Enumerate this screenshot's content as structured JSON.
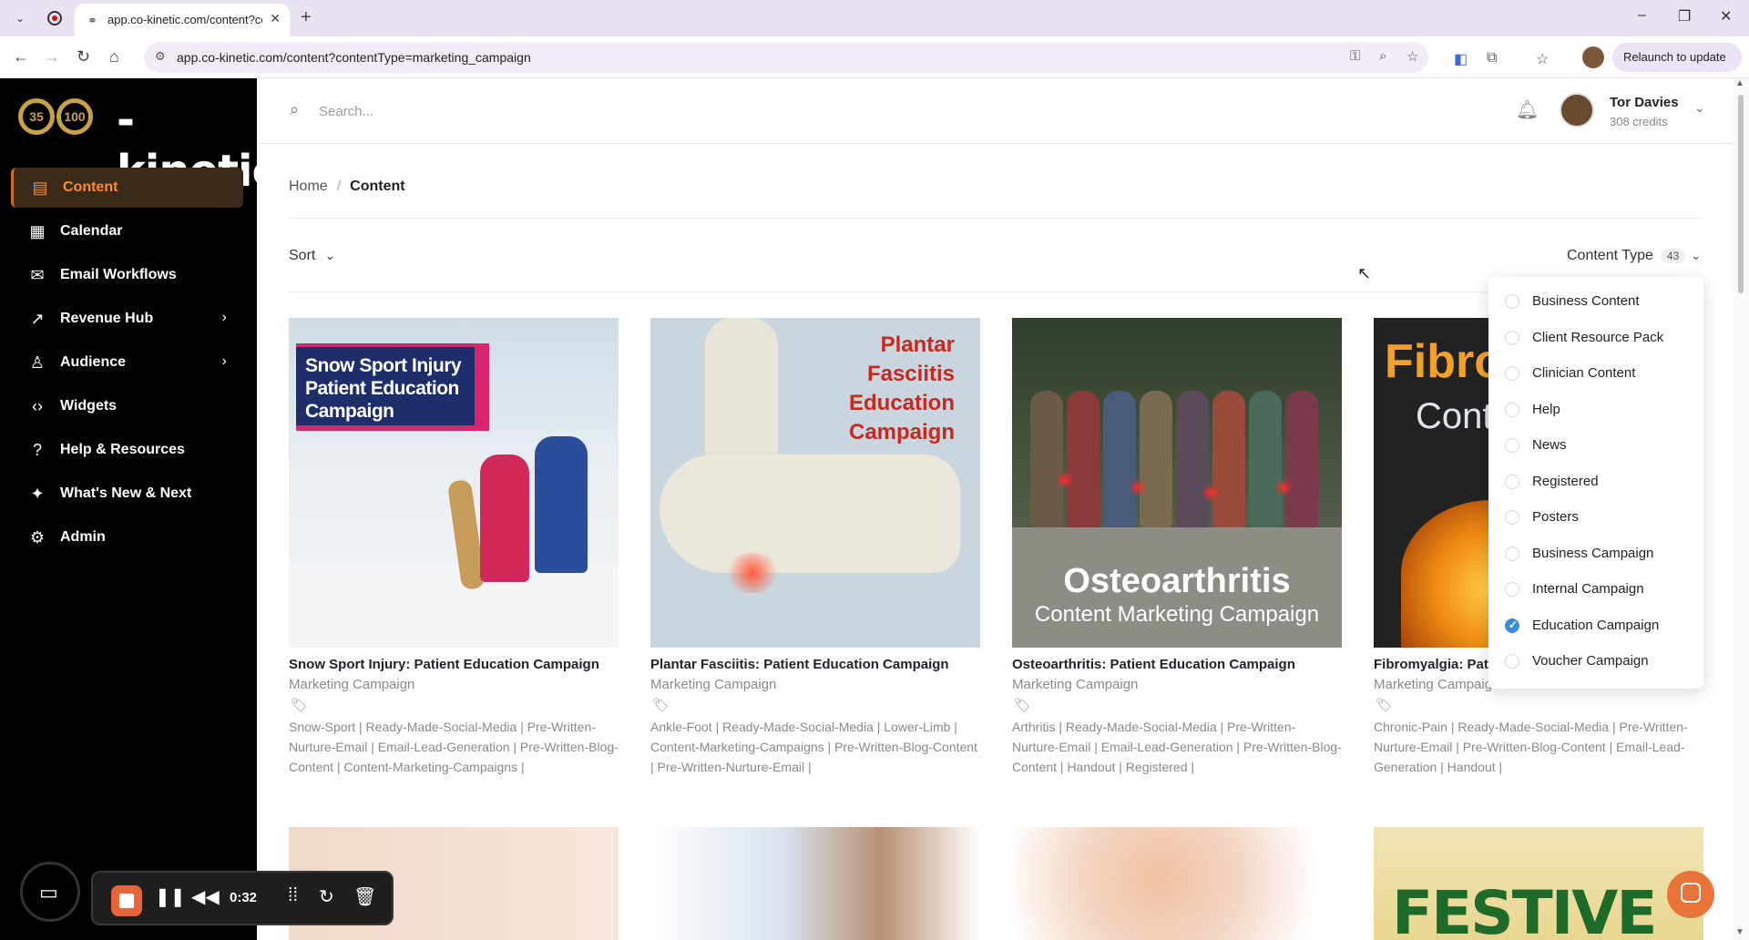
{
  "browser": {
    "tab_title": "app.co-kinetic.com/content?co",
    "url": "app.co-kinetic.com/content?contentType=marketing_campaign",
    "relaunch_label": "Relaunch to update"
  },
  "sidebar": {
    "logo_text": "-kinetic",
    "items": [
      {
        "label": "Content",
        "icon": "document-icon"
      },
      {
        "label": "Calendar",
        "icon": "calendar-icon"
      },
      {
        "label": "Email Workflows",
        "icon": "mail-icon"
      },
      {
        "label": "Revenue Hub",
        "icon": "trend-icon"
      },
      {
        "label": "Audience",
        "icon": "users-icon"
      },
      {
        "label": "Widgets",
        "icon": "code-icon"
      },
      {
        "label": "Help & Resources",
        "icon": "help-icon"
      },
      {
        "label": "What's New & Next",
        "icon": "sparkle-icon"
      },
      {
        "label": "Admin",
        "icon": "gear-icon"
      }
    ]
  },
  "topbar": {
    "search_placeholder": "Search...",
    "user_name": "Tor Davies",
    "user_credits": "308 credits"
  },
  "breadcrumb": {
    "home": "Home",
    "current": "Content"
  },
  "filters": {
    "sort_label": "Sort",
    "content_type_label": "Content Type",
    "content_type_count": "43"
  },
  "dropdown": {
    "options": [
      {
        "label": "Business Content",
        "checked": false
      },
      {
        "label": "Client Resource Pack",
        "checked": false
      },
      {
        "label": "Clinician Content",
        "checked": false
      },
      {
        "label": "Help",
        "checked": false
      },
      {
        "label": "News",
        "checked": false
      },
      {
        "label": "Registered",
        "checked": false
      },
      {
        "label": "Posters",
        "checked": false
      },
      {
        "label": "Business Campaign",
        "checked": false
      },
      {
        "label": "Internal Campaign",
        "checked": false
      },
      {
        "label": "Education Campaign",
        "checked": true
      },
      {
        "label": "Voucher Campaign",
        "checked": false
      }
    ]
  },
  "cards": [
    {
      "title": "Snow Sport Injury: Patient Education Campaign",
      "subtitle": "Marketing Campaign",
      "tags": "Snow-Sport | Ready-Made-Social-Media | Pre-Written-Nurture-Email | Email-Lead-Generation | Pre-Written-Blog-Content | Content-Marketing-Campaigns |",
      "image_text": "Snow Sport Injury Patient Education Campaign"
    },
    {
      "title": "Plantar Fasciitis: Patient Education Campaign",
      "subtitle": "Marketing Campaign",
      "tags": "Ankle-Foot | Ready-Made-Social-Media | Lower-Limb | Content-Marketing-Campaigns | Pre-Written-Blog-Content | Pre-Written-Nurture-Email |",
      "image_text": "Plantar Fasciitis Education Campaign"
    },
    {
      "title": "Osteoarthritis: Patient Education Campaign",
      "subtitle": "Marketing Campaign",
      "tags": "Arthritis | Ready-Made-Social-Media | Pre-Written-Nurture-Email | Email-Lead-Generation | Pre-Written-Blog-Content | Handout | Registered |",
      "image_title": "Osteoarthritis",
      "image_subtitle": "Content Marketing Campaign"
    },
    {
      "title": "Fibromyalgia: Pati",
      "subtitle": "Marketing Campaign",
      "tags": "Chronic-Pain | Ready-Made-Social-Media | Pre-Written-Nurture-Email | Pre-Written-Blog-Content | Email-Lead-Generation | Handout |",
      "image_title": "Fibro",
      "image_subtitle": "Conte"
    }
  ],
  "row2": {
    "festive_text": "FESTIVE"
  },
  "recorder": {
    "time": "0:32"
  },
  "colors": {
    "accent": "#ff8a2a",
    "sidebar_bg": "#000000",
    "checked": "#3a8ed8"
  }
}
